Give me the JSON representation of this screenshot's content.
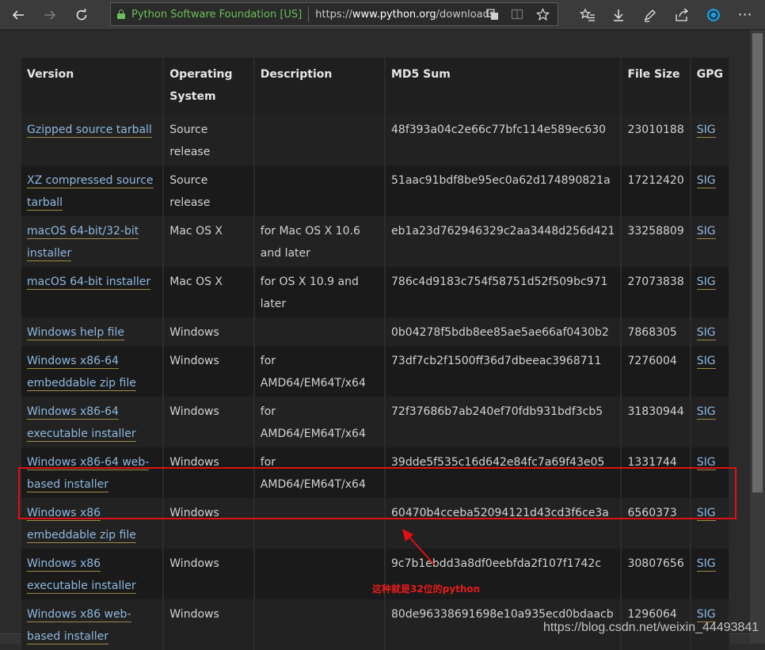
{
  "browser": {
    "back_icon": "arrow-left-icon",
    "forward_icon": "arrow-right-icon",
    "refresh_icon": "refresh-icon",
    "site_identity": "Python Software Foundation [US]",
    "url_prefix": "https://",
    "url_domain": "www.python.org",
    "url_path": "/downloads/re",
    "toolbar_icons": [
      "translate-icon",
      "reading-view-icon",
      "favorite-star-icon",
      "favorites-list-icon",
      "download-icon",
      "pen-icon",
      "share-icon",
      "extension-icon",
      "more-icon"
    ]
  },
  "table": {
    "headers": {
      "version": "Version",
      "os": "Operating System",
      "description": "Description",
      "md5": "MD5 Sum",
      "size": "File Size",
      "gpg": "GPG"
    },
    "rows": [
      {
        "version": "Gzipped source tarball",
        "os": "Source release",
        "description": "",
        "md5": "48f393a04c2e66c77bfc114e589ec630",
        "size": "23010188",
        "gpg": "SIG"
      },
      {
        "version": "XZ compressed source tarball",
        "os": "Source release",
        "description": "",
        "md5": "51aac91bdf8be95ec0a62d174890821a",
        "size": "17212420",
        "gpg": "SIG"
      },
      {
        "version": "macOS 64-bit/32-bit installer",
        "os": "Mac OS X",
        "description": "for Mac OS X 10.6 and later",
        "md5": "eb1a23d762946329c2aa3448d256d421",
        "size": "33258809",
        "gpg": "SIG"
      },
      {
        "version": "macOS 64-bit installer",
        "os": "Mac OS X",
        "description": "for OS X 10.9 and later",
        "md5": "786c4d9183c754f58751d52f509bc971",
        "size": "27073838",
        "gpg": "SIG"
      },
      {
        "version": "Windows help file",
        "os": "Windows",
        "description": "",
        "md5": "0b04278f5bdb8ee85ae5ae66af0430b2",
        "size": "7868305",
        "gpg": "SIG"
      },
      {
        "version": "Windows x86-64 embeddable zip file",
        "os": "Windows",
        "description": "for AMD64/EM64T/x64",
        "md5": "73df7cb2f1500ff36d7dbeeac3968711",
        "size": "7276004",
        "gpg": "SIG"
      },
      {
        "version": "Windows x86-64 executable installer",
        "os": "Windows",
        "description": "for AMD64/EM64T/x64",
        "md5": "72f37686b7ab240ef70fdb931bdf3cb5",
        "size": "31830944",
        "gpg": "SIG"
      },
      {
        "version": "Windows x86-64 web-based installer",
        "os": "Windows",
        "description": "for AMD64/EM64T/x64",
        "md5": "39dde5f535c16d642e84fc7a69f43e05",
        "size": "1331744",
        "gpg": "SIG"
      },
      {
        "version": "Windows x86 embeddable zip file",
        "os": "Windows",
        "description": "",
        "md5": "60470b4cceba52094121d43cd3f6ce3a",
        "size": "6560373",
        "gpg": "SIG"
      },
      {
        "version": "Windows x86 executable installer",
        "os": "Windows",
        "description": "",
        "md5": "9c7b1ebdd3a8df0eebfda2f107f1742c",
        "size": "30807656",
        "gpg": "SIG"
      },
      {
        "version": "Windows x86 web-based installer",
        "os": "Windows",
        "description": "",
        "md5": "80de96338691698e10a935ecd0bdaacb",
        "size": "1296064",
        "gpg": "SIG"
      }
    ]
  },
  "annotation": {
    "note": "这种就是32位的python",
    "color": "#e01010"
  },
  "watermark": "https://blog.csdn.net/weixin_44493841"
}
